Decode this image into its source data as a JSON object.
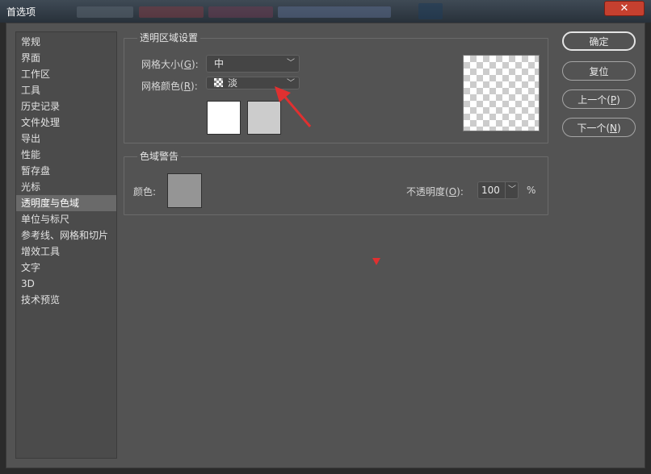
{
  "window": {
    "title": "首选项",
    "close_icon": "close-icon"
  },
  "sidebar": {
    "items": [
      {
        "label": "常规"
      },
      {
        "label": "界面"
      },
      {
        "label": "工作区"
      },
      {
        "label": "工具"
      },
      {
        "label": "历史记录"
      },
      {
        "label": "文件处理"
      },
      {
        "label": "导出"
      },
      {
        "label": "性能"
      },
      {
        "label": "暂存盘"
      },
      {
        "label": "光标"
      },
      {
        "label": "透明度与色域",
        "active": true
      },
      {
        "label": "单位与标尺"
      },
      {
        "label": "参考线、网格和切片"
      },
      {
        "label": "增效工具"
      },
      {
        "label": "文字"
      },
      {
        "label": "3D"
      },
      {
        "label": "技术预览"
      }
    ]
  },
  "transparency": {
    "group_title": "透明区域设置",
    "grid_size": {
      "label_prefix": "网格大小(",
      "key": "G",
      "label_suffix": "):",
      "value": "中"
    },
    "grid_color": {
      "label_prefix": "网格颜色(",
      "key": "R",
      "label_suffix": "):",
      "value": "淡"
    },
    "color1": "#ffffff",
    "color2": "#cccccc"
  },
  "gamut": {
    "group_title": "色域警告",
    "color_label": "颜色:",
    "color": "#959595",
    "opacity": {
      "label_prefix": "不透明度(",
      "key": "O",
      "label_suffix": "):",
      "value": "100",
      "unit": "%"
    }
  },
  "buttons": {
    "ok": {
      "label": "确定"
    },
    "reset": {
      "label": "复位"
    },
    "prev": {
      "label_prefix": "上一个(",
      "key": "P",
      "label_suffix": ")"
    },
    "next": {
      "label_prefix": "下一个(",
      "key": "N",
      "label_suffix": ")"
    }
  },
  "colors": {
    "dialog_bg": "#535353",
    "active_item": "#6a6a6a",
    "annotation": "#e03030"
  }
}
